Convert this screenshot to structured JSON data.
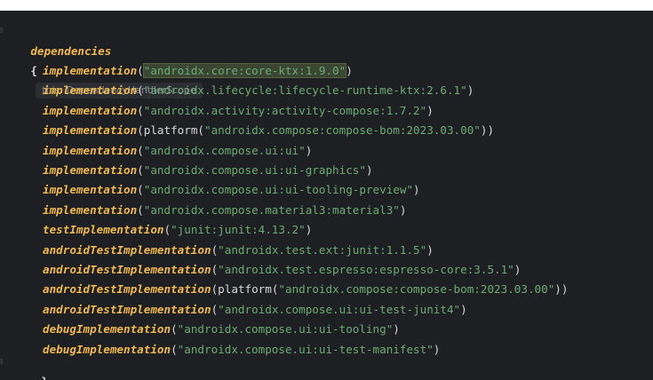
{
  "header": {
    "keyword": "dependencies",
    "open_brace": "{",
    "hint": "this: DependencyHandlerScope"
  },
  "lines": [
    {
      "kw": "implementation",
      "pre": "(",
      "call": "",
      "str": "\"androidx.core:core-ktx:1.9.0\"",
      "post": ")"
    },
    {
      "kw": "implementation",
      "pre": "(",
      "call": "",
      "str": "\"androidx.lifecycle:lifecycle-runtime-ktx:2.6.1\"",
      "post": ")"
    },
    {
      "kw": "implementation",
      "pre": "(",
      "call": "",
      "str": "\"androidx.activity:activity-compose:1.7.2\"",
      "post": ")"
    },
    {
      "kw": "implementation",
      "pre": "(",
      "call": "platform(",
      "str": "\"androidx.compose:compose-bom:2023.03.00\"",
      "post": "))"
    },
    {
      "kw": "implementation",
      "pre": "(",
      "call": "",
      "str": "\"androidx.compose.ui:ui\"",
      "post": ")"
    },
    {
      "kw": "implementation",
      "pre": "(",
      "call": "",
      "str": "\"androidx.compose.ui:ui-graphics\"",
      "post": ")"
    },
    {
      "kw": "implementation",
      "pre": "(",
      "call": "",
      "str": "\"androidx.compose.ui:ui-tooling-preview\"",
      "post": ")"
    },
    {
      "kw": "implementation",
      "pre": "(",
      "call": "",
      "str": "\"androidx.compose.material3:material3\"",
      "post": ")"
    },
    {
      "kw": "testImplementation",
      "pre": "(",
      "call": "",
      "str": "\"junit:junit:4.13.2\"",
      "post": ")"
    },
    {
      "kw": "androidTestImplementation",
      "pre": "(",
      "call": "",
      "str": "\"androidx.test.ext:junit:1.1.5\"",
      "post": ")"
    },
    {
      "kw": "androidTestImplementation",
      "pre": "(",
      "call": "",
      "str": "\"androidx.test.espresso:espresso-core:3.5.1\"",
      "post": ")"
    },
    {
      "kw": "androidTestImplementation",
      "pre": "(",
      "call": "platform(",
      "str": "\"androidx.compose:compose-bom:2023.03.00\"",
      "post": "))"
    },
    {
      "kw": "androidTestImplementation",
      "pre": "(",
      "call": "",
      "str": "\"androidx.compose.ui:ui-test-junit4\"",
      "post": ")"
    },
    {
      "kw": "debugImplementation",
      "pre": "(",
      "call": "",
      "str": "\"androidx.compose.ui:ui-tooling\"",
      "post": ")"
    },
    {
      "kw": "debugImplementation",
      "pre": "(",
      "call": "",
      "str": "\"androidx.compose.ui:ui-test-manifest\"",
      "post": ")"
    }
  ],
  "footer": {
    "close_brace": "}"
  },
  "colors": {
    "background": "#1e1f22",
    "keyword": "#f0b94d",
    "string": "#6aab73",
    "punctuation": "#d6d8dc",
    "hint_bg": "#2b2d31",
    "hint_text": "#8a8d93"
  }
}
